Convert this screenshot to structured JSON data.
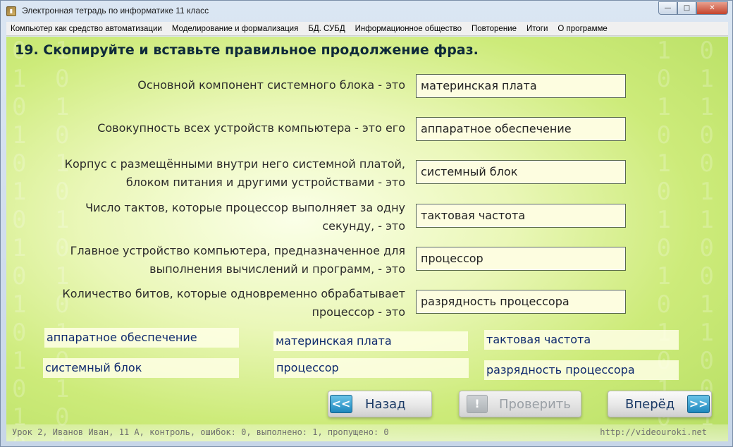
{
  "window": {
    "title": "Электронная тетрадь по информатике 11 класс",
    "icon": "app-book-icon",
    "controls": {
      "minimize": "—",
      "maximize": "□",
      "close": "✕"
    }
  },
  "menu": [
    "Компьютер как средство автоматизации",
    "Моделирование и формализация",
    "БД. СУБД",
    "Информационное общество",
    "Повторение",
    "Итоги",
    "О программе"
  ],
  "question": "19. Скопируйте и вставьте правильное продолжение фраз.",
  "pairs": [
    {
      "prompt_lines": [
        "Основной компонент системного блока - это"
      ],
      "answer": "материнская плата"
    },
    {
      "prompt_lines": [
        "Совокупность всех устройств компьютера - это его"
      ],
      "answer": "аппаратное обеспечение"
    },
    {
      "prompt_lines": [
        "Корпус с размещёнными внутри него системной платой,",
        "блоком питания и другими устройствами - это"
      ],
      "answer": "системный блок"
    },
    {
      "prompt_lines": [
        "Число тактов, которые процессор выполняет за одну",
        "секунду, - это"
      ],
      "answer": "тактовая частота"
    },
    {
      "prompt_lines": [
        "Главное устройство компьютера, предназначенное для",
        "выполнения вычислений и программ, - это"
      ],
      "answer": "процессор"
    },
    {
      "prompt_lines": [
        "Количество битов, которые одновременно обрабатывает",
        "процессор - это"
      ],
      "answer": "разрядность процессора"
    }
  ],
  "options": [
    "аппаратное обеспечение",
    "материнская плата",
    "тактовая частота",
    "системный блок",
    "процессор",
    "разрядность процессора"
  ],
  "buttons": {
    "back": {
      "label": "Назад",
      "arrows": "<<"
    },
    "check": {
      "label": "Проверить",
      "icon": "!"
    },
    "forward": {
      "label": "Вперёд",
      "arrows": ">>"
    }
  },
  "status": {
    "left": "Урок 2, Иванов Иван, 11 А, контроль, ошибок: 0, выполнено: 1, пропущено: 0",
    "right": "http://videouroki.net"
  },
  "colors": {
    "accent_blue": "#1d87bd",
    "answer_bg": "#fdfde0",
    "background_green": "#cdeb7a"
  }
}
